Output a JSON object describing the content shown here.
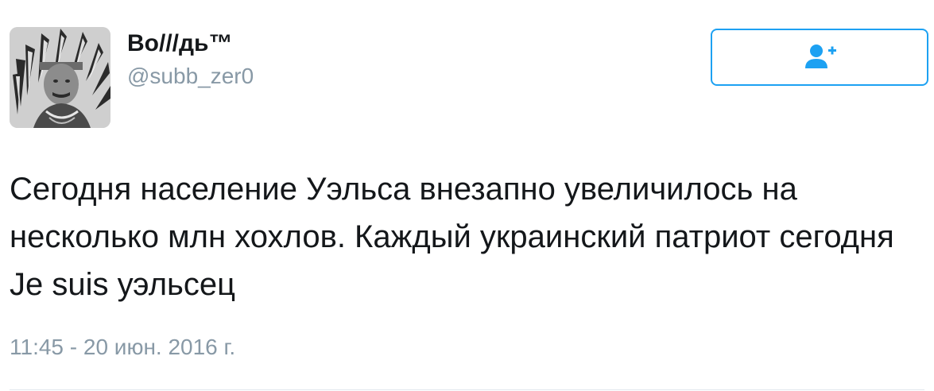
{
  "author": {
    "display_name": "Во///дь™",
    "handle": "@subb_zer0",
    "avatar_icon": "avatar-portrait-headdress"
  },
  "follow_button": {
    "icon": "add-user-icon",
    "accent_color": "#1da1f2"
  },
  "tweet": {
    "text": "Сегодня население Уэльса внезапно увеличилось на несколько млн хохлов. Каждый украинский патриот сегодня Je suis уэльсец",
    "timestamp": "11:45 - 20 июн. 2016 г."
  },
  "colors": {
    "text_primary": "#14171a",
    "text_secondary": "#8899a6",
    "divider": "#e1e8ed"
  }
}
